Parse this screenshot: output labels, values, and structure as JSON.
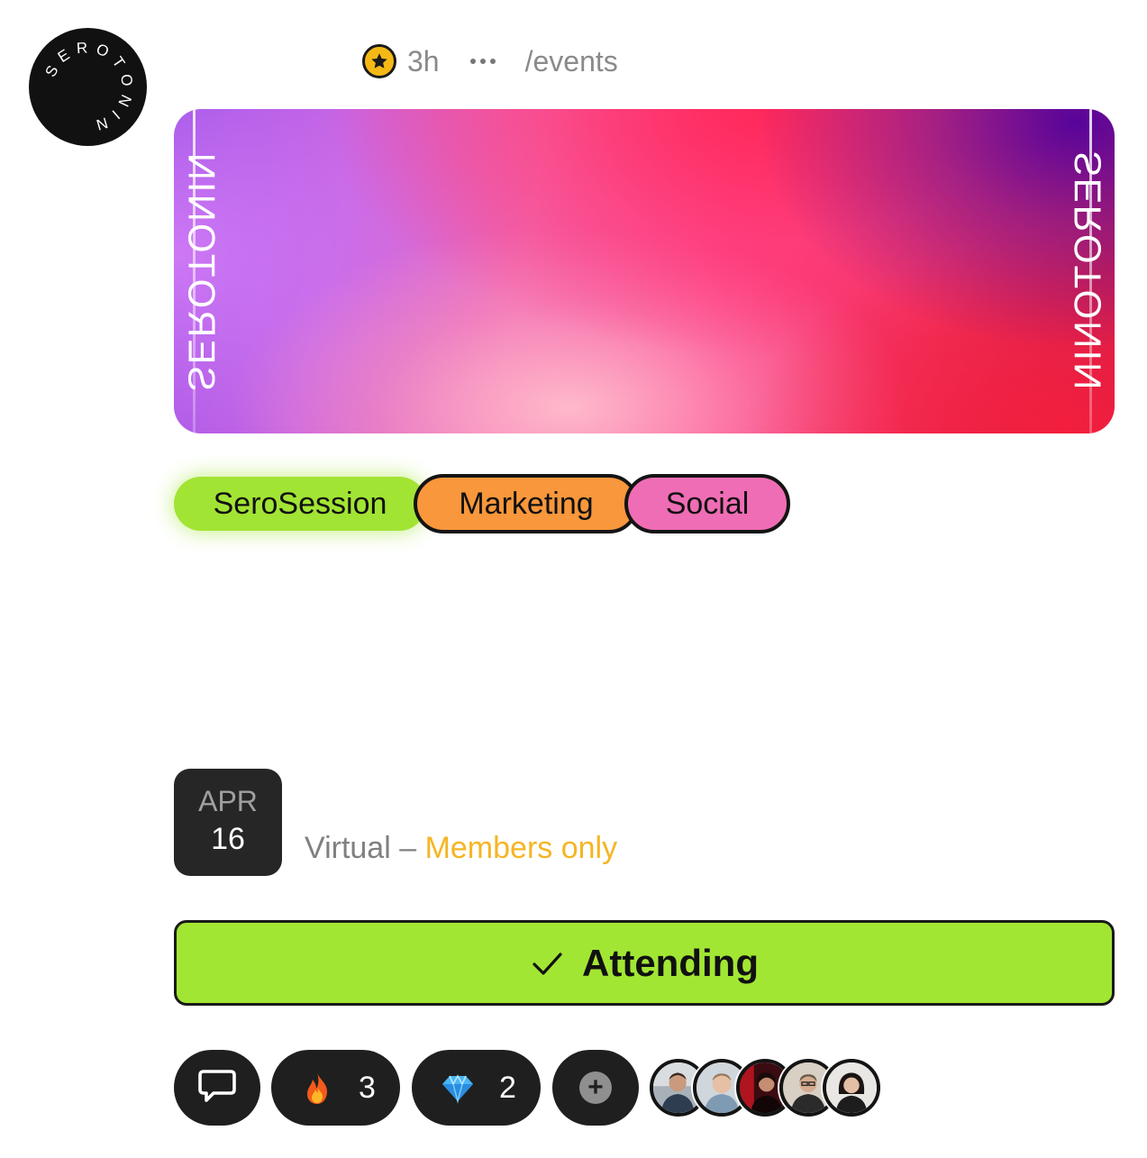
{
  "profile": {
    "logo_text": "SEROTONIN",
    "logo_icon": "serotonin-circular-wordmark"
  },
  "post_meta": {
    "badge_icon": "star-icon",
    "time_ago": "3h",
    "more_icon": "more-horizontal-icon",
    "channel": "/events"
  },
  "banner": {
    "edge_text_left": "SEROTONIN",
    "edge_text_right": "SEROTONIN"
  },
  "tags": [
    {
      "label": "SeroSession",
      "color": "#a2e434"
    },
    {
      "label": "Marketing",
      "color": "#f8973b"
    },
    {
      "label": "Social",
      "color": "#ef6db4"
    }
  ],
  "event": {
    "month": "APR",
    "day": "16",
    "location": "Virtual",
    "separator": " – ",
    "access": "Members only",
    "access_color": "#f5b523"
  },
  "rsvp": {
    "label": "Attending",
    "icon": "checkmark-icon",
    "color": "#a2e634"
  },
  "actions": {
    "comment_icon": "comment-icon",
    "reactions": [
      {
        "emoji": "fire-icon",
        "count": "3"
      },
      {
        "emoji": "gem-icon",
        "count": "2"
      }
    ],
    "add_reaction_icon": "plus-icon"
  },
  "attendees": [
    {
      "name": "attendee-1"
    },
    {
      "name": "attendee-2"
    },
    {
      "name": "attendee-3"
    },
    {
      "name": "attendee-4"
    },
    {
      "name": "attendee-5"
    }
  ]
}
